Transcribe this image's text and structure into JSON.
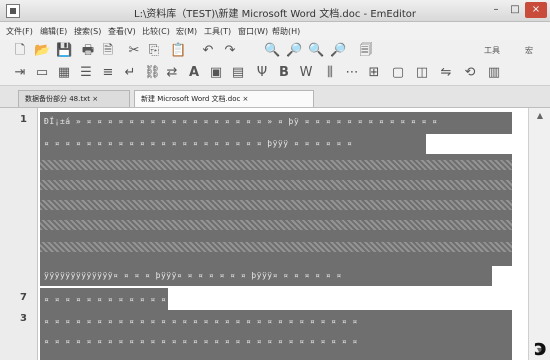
{
  "window": {
    "title": "L:\\资料库（TEST)\\新建 Microsoft Word 文档.doc - EmEditor",
    "min": "–",
    "max": "□",
    "close": "×"
  },
  "menu": [
    "文件(F)",
    "编辑(E)",
    "搜索(S)",
    "查看(V)",
    "比较(C)",
    "宏(M)",
    "工具(T)",
    "窗口(W)",
    "帮助(H)"
  ],
  "toolbar1": [
    {
      "icon": "new-doc-icon",
      "glyph": "🗋"
    },
    {
      "icon": "open-icon",
      "glyph": "📂"
    },
    {
      "icon": "save-icon",
      "glyph": "💾"
    },
    {
      "icon": "print-icon",
      "glyph": "🖶"
    },
    {
      "icon": "print-preview-icon",
      "glyph": "🗎"
    },
    {
      "icon": "cut-icon",
      "glyph": "✂"
    },
    {
      "icon": "copy-icon",
      "glyph": "⎘"
    },
    {
      "icon": "paste-icon",
      "glyph": "📋"
    },
    {
      "icon": "undo-icon",
      "glyph": "↶"
    },
    {
      "icon": "redo-icon",
      "glyph": "↷"
    },
    {
      "icon": "find-icon",
      "glyph": "🔍"
    },
    {
      "icon": "find-next-icon",
      "glyph": "🔎"
    },
    {
      "icon": "find-prev-icon",
      "glyph": "🔍"
    },
    {
      "icon": "replace-icon",
      "glyph": "🔎"
    },
    {
      "icon": "find-in-files-icon",
      "glyph": "🗐"
    }
  ],
  "toolbar1_right": [
    {
      "icon": "tools-icon",
      "label": "工具"
    },
    {
      "icon": "macro-icon",
      "label": "宏"
    }
  ],
  "toolbar2": [
    {
      "icon": "indent-icon",
      "glyph": "⇥"
    },
    {
      "icon": "frame-icon",
      "glyph": "▭"
    },
    {
      "icon": "table-icon",
      "glyph": "▦"
    },
    {
      "icon": "list-icon",
      "glyph": "☰"
    },
    {
      "icon": "align-icon",
      "glyph": "≡"
    },
    {
      "icon": "wrap-icon",
      "glyph": "↵"
    },
    {
      "icon": "link-icon",
      "glyph": "⛓"
    },
    {
      "icon": "translate-icon",
      "glyph": "⇄"
    },
    {
      "icon": "font-icon",
      "glyph": "A"
    },
    {
      "icon": "image-icon",
      "glyph": "▣"
    },
    {
      "icon": "format-icon",
      "glyph": "▤"
    },
    {
      "icon": "spell-icon",
      "glyph": "Ψ"
    },
    {
      "icon": "bold-icon",
      "glyph": "B"
    },
    {
      "icon": "word-icon",
      "glyph": "W"
    },
    {
      "icon": "column-icon",
      "glyph": "⫼"
    },
    {
      "icon": "code-icon",
      "glyph": "⋯"
    },
    {
      "icon": "grid-icon",
      "glyph": "⊞"
    },
    {
      "icon": "window-icon",
      "glyph": "▢"
    },
    {
      "icon": "split-icon",
      "glyph": "◫"
    },
    {
      "icon": "compare-icon",
      "glyph": "⇋"
    },
    {
      "icon": "sync-icon",
      "glyph": "⟲"
    },
    {
      "icon": "options-icon",
      "glyph": "▥"
    }
  ],
  "tabs": [
    {
      "label": "数据备份部分 48.txt ×"
    },
    {
      "label": "新建 Microsoft Word 文档.doc ×"
    }
  ],
  "editor": {
    "line_numbers": [
      "1",
      "7",
      "3"
    ],
    "visible_text": {
      "line1_a": "ÐÏ¡±á  »  ¤  ¤  ¤  ¤  ¤  ¤  ¤  ¤  ¤  ¤  ¤  ¤  ¤  ¤  ¤  ¤  ¤  »  ¤  þÿ  ¤  ¤  ¤  ¤  ¤  ¤  ¤  ¤  ¤  ¤  ¤  ¤  ¤",
      "line1_b": "¤  ¤  ¤  ¤  ¤  ¤  ¤  ¤  ¤  ¤  ¤  ¤  ¤  ¤  ¤  ¤  ¤  ¤  ¤  ¤  ¤  þÿÿÿ  ¤  ¤  ¤  ¤  ¤  ¤",
      "line1_end": "ÿÿÿÿÿÿÿÿÿÿÿÿÿ¤  ¤  ¤  ¤  þÿÿÿ¤  ¤  ¤  ¤  ¤  ¤  ¤  þÿÿÿ¤  ¤  ¤  ¤  ¤  ¤  ¤",
      "line2": "¤  ¤  ¤  ¤  ¤  ¤  ¤  ¤  ¤  ¤  ¤  ¤  ¤",
      "line3_a": "¤  ¤  ¤  ¤  ¤  ¤  ¤  ¤  ¤  ¤  ¤  ¤  ¤  ¤  ¤  ¤  ¤  ¤  ¤  ¤  ¤  ¤  ¤  ¤  ¤  ¤  ¤  ¤  ¤  ¤",
      "line3_b": "¤  ¤  ¤  ¤  ¤  ¤  ¤  ¤  ¤  ¤  ¤  ¤  ¤  ¤  ¤  ¤  ¤  ¤  ¤  ¤  ¤  ¤  ¤  ¤  ¤  ¤  ¤  ¤  ¤  ¤"
    }
  },
  "scrollbar": {
    "up": "▲",
    "down": "▼"
  },
  "overlay_mark": "ↄ"
}
